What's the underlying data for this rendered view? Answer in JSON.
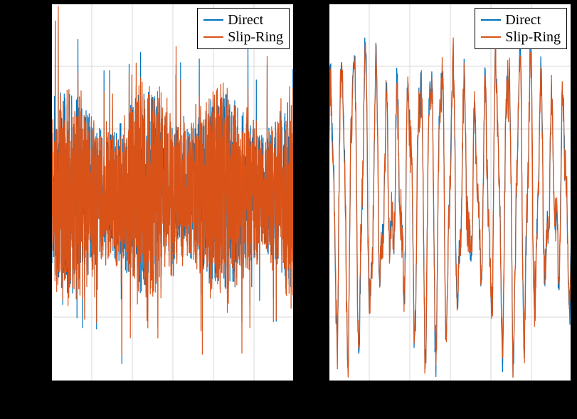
{
  "chart_data": [
    {
      "type": "line",
      "title": "",
      "xlabel": "",
      "ylabel": "",
      "ylim": [
        -1.0,
        1.0
      ],
      "xlim": [
        0,
        1
      ],
      "legend_position": "top-right",
      "series": [
        {
          "name": "Direct",
          "description": "dense noisy signal, amplitude mostly within ±0.55, spikes to ±0.95"
        },
        {
          "name": "Slip-Ring",
          "description": "dense noisy signal overlapping Direct, similar envelope"
        }
      ],
      "gridlines_y": 5,
      "gridlines_x": 6
    },
    {
      "type": "line",
      "title": "",
      "xlabel": "",
      "ylabel": "",
      "ylim": [
        -1.0,
        1.0
      ],
      "xlim": [
        0,
        1
      ],
      "legend_position": "top-right",
      "series": [
        {
          "name": "Direct",
          "description": "oscillating signal, ~40 cycles, amplitude varying ±0.3 to ±0.9"
        },
        {
          "name": "Slip-Ring",
          "description": "closely follows Direct with slight deviations"
        }
      ],
      "gridlines_y": 5,
      "gridlines_x": 6
    }
  ],
  "legend": {
    "items": [
      {
        "label": "Direct",
        "color": "#0072bd"
      },
      {
        "label": "Slip-Ring",
        "color": "#d95319"
      }
    ]
  }
}
